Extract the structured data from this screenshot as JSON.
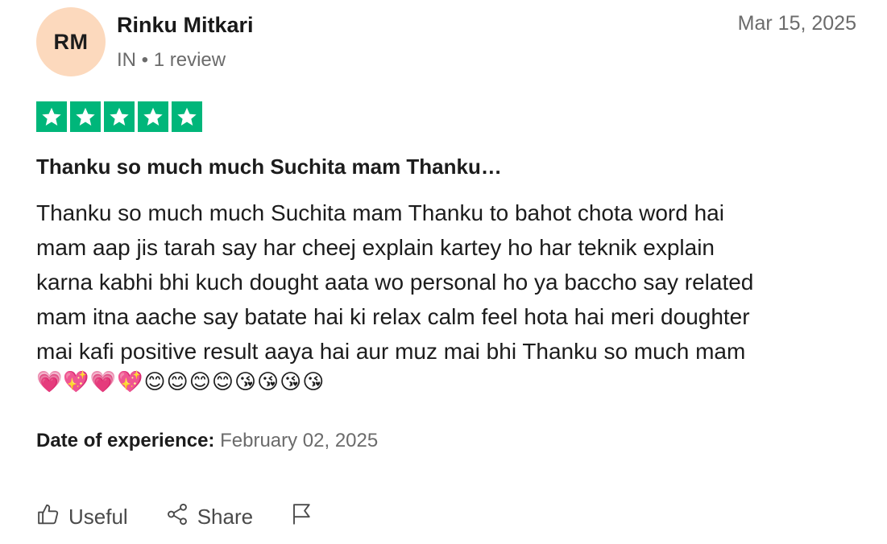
{
  "reviewer": {
    "initials": "RM",
    "name": "Rinku Mitkari",
    "meta": "IN • 1 review",
    "avatar_color": "#fcd9bd"
  },
  "review": {
    "date": "Mar 15, 2025",
    "rating": 5,
    "star_color": "#00b67a",
    "title": "Thanku so much much Suchita mam Thanku…",
    "body_lines": [
      "Thanku so much much Suchita mam Thanku to bahot chota word hai",
      "mam aap jis tarah say har cheej explain kartey ho har teknik explain",
      "karna kabhi bhi kuch dought aata wo personal ho ya baccho say related",
      "mam itna aache say batate hai ki relax calm feel hota hai meri doughter",
      "mai kafi positive result aaya hai aur muz mai bhi Thanku so much mam"
    ],
    "emojis": [
      "💗",
      "💖",
      "💗",
      "💖",
      "😊",
      "😊",
      "😊",
      "😊",
      "😘",
      "😘",
      "😘",
      "😘"
    ]
  },
  "experience": {
    "label": "Date of experience:",
    "value": "February 02, 2025"
  },
  "actions": {
    "useful_label": "Useful",
    "share_label": "Share",
    "icons": [
      "thumbs-up-icon",
      "share-icon",
      "flag-icon"
    ]
  }
}
